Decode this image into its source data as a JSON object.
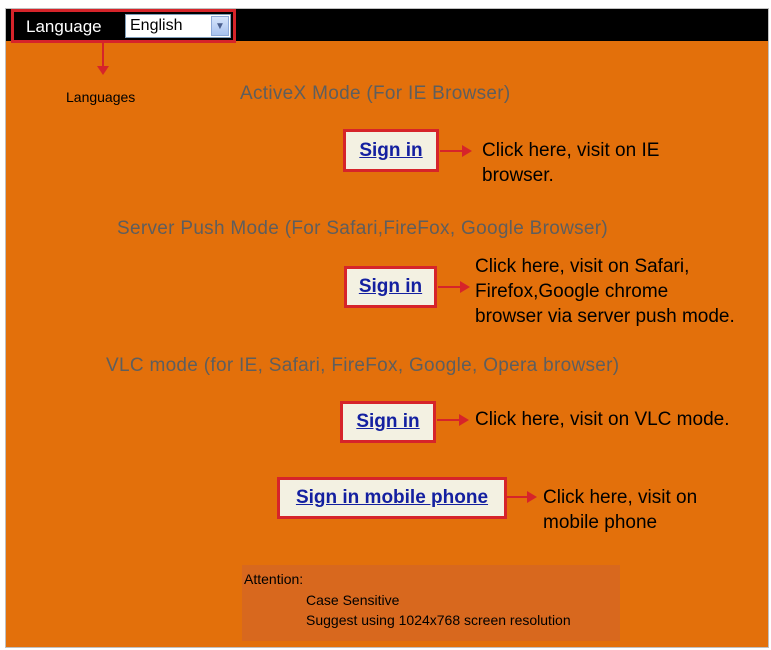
{
  "header": {
    "language_label": "Language",
    "language_select": {
      "value": "English"
    },
    "languages_caption": "Languages"
  },
  "modes": [
    {
      "title": "ActiveX Mode (For IE Browser)",
      "signin_label": "Sign in",
      "hint": [
        "Click here, visit on IE",
        "browser."
      ]
    },
    {
      "title": "Server Push Mode (For Safari,FireFox, Google Browser)",
      "signin_label": "Sign in",
      "hint": [
        "Click here, visit on Safari,",
        "Firefox,Google chrome",
        "browser via server push mode."
      ]
    },
    {
      "title": "VLC mode (for IE, Safari, FireFox, Google, Opera browser)",
      "signin_label": "Sign in",
      "hint": [
        "Click here, visit on VLC mode."
      ]
    }
  ],
  "mobile": {
    "signin_label": "Sign in mobile phone",
    "hint": [
      "Click here, visit on",
      "mobile phone"
    ]
  },
  "attention": {
    "title": "Attention:",
    "lines": [
      "Case Sensitive",
      "Suggest using 1024x768 screen resolution"
    ]
  },
  "colors": {
    "background": "#e3700b",
    "highlight_border": "#d6242a",
    "link": "#1420a0"
  }
}
